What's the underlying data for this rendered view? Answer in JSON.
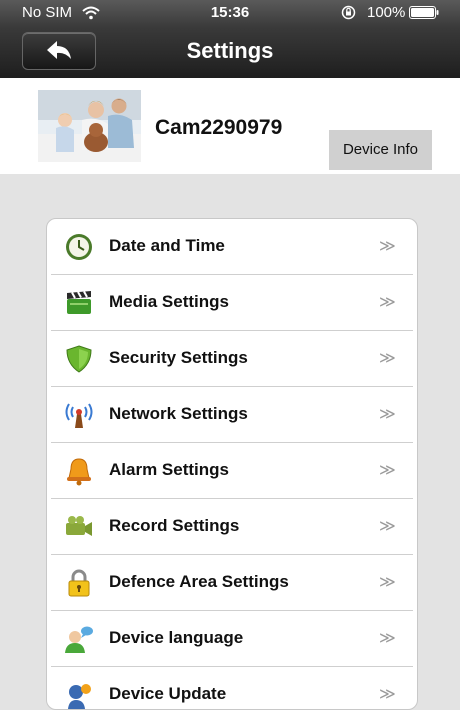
{
  "status": {
    "carrier": "No SIM",
    "time": "15:36",
    "battery": "100%"
  },
  "header": {
    "title": "Settings"
  },
  "camera": {
    "name": "Cam2290979",
    "device_info_label": "Device Info"
  },
  "menu": {
    "arrow": "≫",
    "items": [
      {
        "label": "Date and Time",
        "icon": "clock-icon"
      },
      {
        "label": "Media Settings",
        "icon": "clapperboard-icon"
      },
      {
        "label": "Security Settings",
        "icon": "shield-icon"
      },
      {
        "label": "Network Settings",
        "icon": "antenna-icon"
      },
      {
        "label": "Alarm Settings",
        "icon": "bell-icon"
      },
      {
        "label": "Record Settings",
        "icon": "camcorder-icon"
      },
      {
        "label": "Defence Area Settings",
        "icon": "padlock-icon"
      },
      {
        "label": "Device language",
        "icon": "person-speech-icon"
      },
      {
        "label": "Device Update",
        "icon": "update-icon"
      }
    ]
  }
}
